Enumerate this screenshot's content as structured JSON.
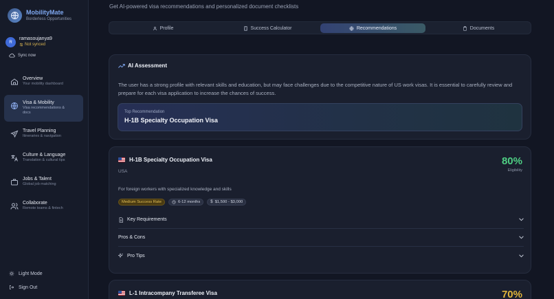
{
  "brand": {
    "name": "MobilityMate",
    "tagline": "Borderless Opportunities"
  },
  "user": {
    "avatar_initial": "R",
    "name": "ramasoujanya9",
    "status": "Not synced",
    "sync_label": "Sync now"
  },
  "sidebar": {
    "items": [
      {
        "label": "Overview",
        "desc": "Your mobility dashboard",
        "icon": "home-icon"
      },
      {
        "label": "Visa & Mobility",
        "desc": "Visa recommendations & docs",
        "icon": "globe-icon",
        "active": true
      },
      {
        "label": "Travel Planning",
        "desc": "Itineraries & navigation",
        "icon": "plane-icon"
      },
      {
        "label": "Culture & Language",
        "desc": "Translation & cultural tips",
        "icon": "translate-icon"
      },
      {
        "label": "Jobs & Talent",
        "desc": "Global job matching",
        "icon": "briefcase-icon"
      },
      {
        "label": "Collaborate",
        "desc": "Remote teams & fintech",
        "icon": "users-icon"
      }
    ],
    "light_mode": "Light Mode",
    "sign_out": "Sign Out"
  },
  "main": {
    "subtitle": "Get AI-powered visa recommendations and personalized document checklists",
    "tabs": [
      {
        "label": "Profile",
        "icon": "user-icon"
      },
      {
        "label": "Success Calculator",
        "icon": "calculator-icon"
      },
      {
        "label": "Recommendations",
        "icon": "globe-icon",
        "active": true
      },
      {
        "label": "Documents",
        "icon": "clipboard-icon"
      }
    ]
  },
  "assessment": {
    "title": "AI Assessment",
    "text": "The user has a strong profile with relevant skills and education, but may face challenges due to the competitive nature of US work visas. It is essential to carefully review and prepare for each visa application to increase the chances of success.",
    "top_label": "Top Recommendation",
    "top_value": "H-1B Specialty Occupation Visa"
  },
  "visas": [
    {
      "name": "H-1B Specialty Occupation Visa",
      "country": "USA",
      "eligibility": "80%",
      "eligibility_label": "Eligibility",
      "description": "For foreign workers with specialized knowledge and skills",
      "badges": {
        "success": "Medium Success Rate",
        "time": "6-12 months",
        "cost": "$1,500 - $3,000"
      },
      "sections": [
        "Key Requirements",
        "Pros & Cons",
        "Pro Tips"
      ]
    },
    {
      "name": "L-1 Intracompany Transferee Visa",
      "eligibility": "70%"
    }
  ],
  "colors": {
    "accent": "#7fa8f0",
    "success": "#4fcf84",
    "warning": "#e0b43a",
    "background": "#121623"
  }
}
